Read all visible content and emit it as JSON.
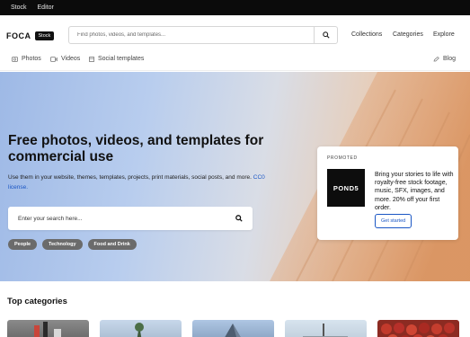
{
  "topbar": {
    "items": [
      "Stock",
      "Editor"
    ]
  },
  "header": {
    "logo": "FOCA",
    "logo_badge": "Stock",
    "search_placeholder": "Find photos, videos, and templates...",
    "nav": [
      "Collections",
      "Categories",
      "Explore"
    ]
  },
  "subnav": {
    "items": [
      {
        "label": "Photos",
        "icon": "photo-icon"
      },
      {
        "label": "Videos",
        "icon": "video-icon"
      },
      {
        "label": "Social templates",
        "icon": "template-icon"
      }
    ],
    "blog": {
      "label": "Blog",
      "icon": "blog-icon"
    }
  },
  "hero": {
    "title": "Free photos, videos, and templates for commercial use",
    "subtitle": "Use them in your website, themes, templates, projects, print materials, social posts, and more.",
    "license_link": "CC0 license.",
    "search_placeholder": "Enter your search here...",
    "tags": [
      "People",
      "Technology",
      "Food and Drink"
    ]
  },
  "promo": {
    "label": "PROMOTED",
    "brand": "POND5",
    "text": "Bring your stories to life with royalty-free stock footage, music, SFX, images, and more. 20% off your first order.",
    "button": "Get started"
  },
  "categories": {
    "title": "Top categories"
  },
  "colors": {
    "accent": "#1a56c4",
    "topbar": "#0b0b0b",
    "tag": "#6b6b6b"
  }
}
